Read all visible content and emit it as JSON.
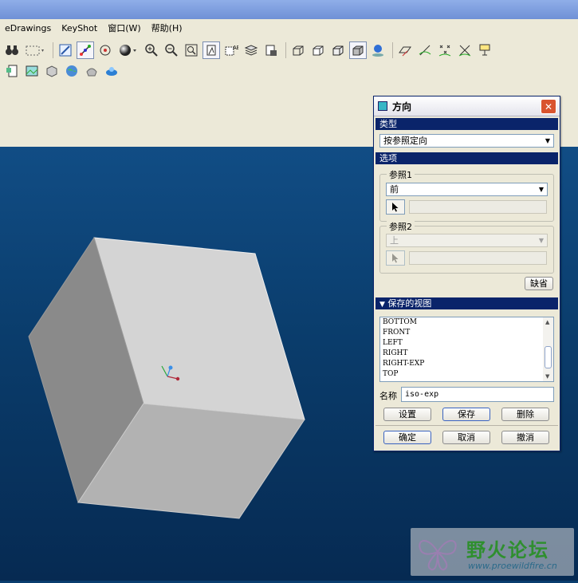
{
  "menubar": {
    "items": [
      "eDrawings",
      "KeyShot",
      "窗口(W)",
      "帮助(H)"
    ]
  },
  "toolbar": {
    "row1": [
      "binoculars-icon",
      "select-box-icon",
      "repaint-icon",
      "spin-center-icon",
      "orient-mode-icon",
      "sphere-icon",
      "zoom-in-icon",
      "zoom-out-icon",
      "refit-icon",
      "view-manager-icon",
      "named-view-icon",
      "layers-icon",
      "display-style-icon",
      "wireframe-icon",
      "hidden-line-icon",
      "no-hidden-icon",
      "shading-icon",
      "appearance-icon",
      "datum-planes-icon",
      "datum-axes-icon",
      "datum-points-icon",
      "csys-icon",
      "annotation-icon"
    ],
    "row2": [
      "model-tree-icon",
      "image-icon",
      "analysis-icon",
      "globe-icon",
      "render-icon",
      "keyshot-icon"
    ]
  },
  "dialog": {
    "title": "方向",
    "close": "✕",
    "type_section": "类型",
    "type_value": "按参照定向",
    "options_section": "选项",
    "ref1_label": "参照1",
    "ref1_value": "前",
    "ref2_label": "参照2",
    "ref2_value": "上",
    "default_btn": "缺省",
    "saved_views_section": "保存的视图",
    "saved_views": [
      "BOTTOM",
      "FRONT",
      "LEFT",
      "RIGHT",
      "RIGHT-EXP",
      "TOP"
    ],
    "name_label": "名称",
    "name_value": "iso-exp",
    "set_btn": "设置",
    "save_btn": "保存",
    "delete_btn": "删除",
    "ok_btn": "确定",
    "cancel_btn": "取消",
    "undo_btn": "撤消"
  },
  "watermark": {
    "title": "野火论坛",
    "url": "www.proewildfire.cn"
  },
  "colors": {
    "accent": "#0a246a",
    "viewport_top": "#114d85",
    "viewport_bottom": "#062a52"
  }
}
